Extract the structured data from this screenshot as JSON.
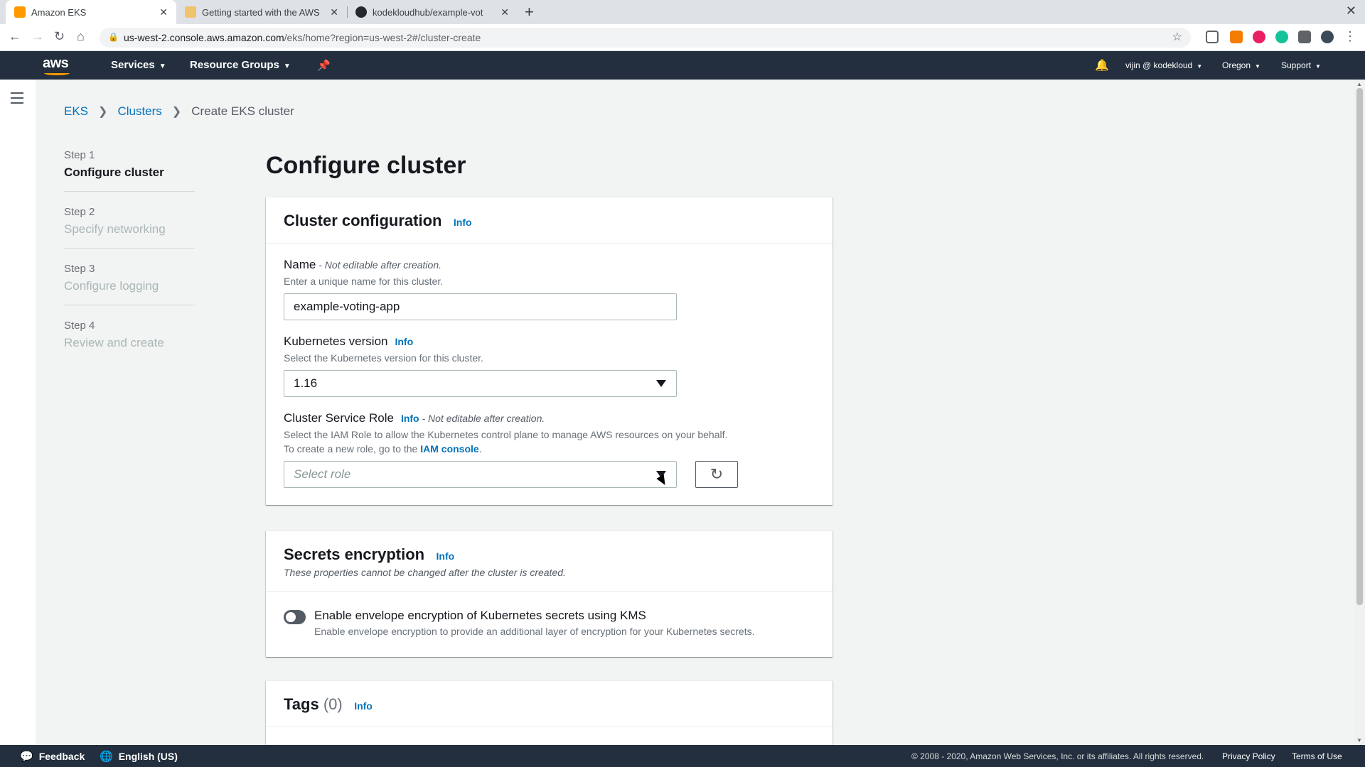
{
  "browser": {
    "tabs": [
      {
        "title": "Amazon EKS",
        "favicon_color": "#ff9900",
        "active": true
      },
      {
        "title": "Getting started with the AWS",
        "favicon_color": "#f0c36d",
        "active": false
      },
      {
        "title": "kodekloudhub/example-vot",
        "favicon_color": "#24292e",
        "active": false
      }
    ],
    "url_host": "us-west-2.console.aws.amazon.com",
    "url_path": "/eks/home?region=us-west-2#/cluster-create"
  },
  "aws_header": {
    "logo": "aws",
    "services": "Services",
    "resource_groups": "Resource Groups",
    "user": "vijin @ kodekloud",
    "region": "Oregon",
    "support": "Support"
  },
  "breadcrumb": {
    "items": [
      "EKS",
      "Clusters"
    ],
    "current": "Create EKS cluster"
  },
  "steps": [
    {
      "num": "Step 1",
      "label": "Configure cluster"
    },
    {
      "num": "Step 2",
      "label": "Specify networking"
    },
    {
      "num": "Step 3",
      "label": "Configure logging"
    },
    {
      "num": "Step 4",
      "label": "Review and create"
    }
  ],
  "page_title": "Configure cluster",
  "cluster_config": {
    "title": "Cluster configuration",
    "info": "Info",
    "name_label": "Name",
    "name_note": " - Not editable after creation.",
    "name_desc": "Enter a unique name for this cluster.",
    "name_value": "example-voting-app",
    "k8s_label": "Kubernetes version",
    "k8s_info": "Info",
    "k8s_desc": "Select the Kubernetes version for this cluster.",
    "k8s_value": "1.16",
    "role_label": "Cluster Service Role",
    "role_info": "Info",
    "role_note": " - Not editable after creation.",
    "role_desc1": "Select the IAM Role to allow the Kubernetes control plane to manage AWS resources on your behalf.",
    "role_desc2_pre": "To create a new role, go to the ",
    "role_desc2_link": "IAM console",
    "role_desc2_post": ".",
    "role_placeholder": "Select role"
  },
  "secrets": {
    "title": "Secrets encryption",
    "info": "Info",
    "desc": "These properties cannot be changed after the cluster is created.",
    "toggle_label": "Enable envelope encryption of Kubernetes secrets using KMS",
    "toggle_desc": "Enable envelope encryption to provide an additional layer of encryption for your Kubernetes secrets.",
    "toggle_on": false
  },
  "tags": {
    "title": "Tags",
    "count": "(0)",
    "info": "Info"
  },
  "footer": {
    "feedback": "Feedback",
    "language": "English (US)",
    "copyright": "© 2008 - 2020, Amazon Web Services, Inc. or its affiliates. All rights reserved.",
    "privacy": "Privacy Policy",
    "terms": "Terms of Use"
  },
  "colors": {
    "aws_nav": "#232f3e",
    "link": "#0073bb",
    "aws_orange": "#ff9900"
  }
}
